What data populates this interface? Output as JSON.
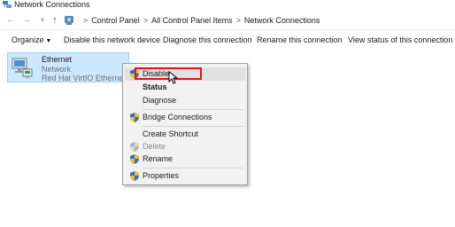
{
  "window": {
    "title": "Network Connections"
  },
  "address": {
    "breadcrumbs": [
      "Control Panel",
      "All Control Panel Items",
      "Network Connections"
    ]
  },
  "toolbar": {
    "organize": "Organize",
    "disable": "Disable this network device",
    "diagnose": "Diagnose this connection",
    "rename": "Rename this connection",
    "status": "View status of this connection"
  },
  "adapter": {
    "name": "Ethernet",
    "network": "Network",
    "device": "Red Hat VirtIO Ethernet Adapter"
  },
  "context_menu": {
    "items": [
      "Disable",
      "Status",
      "Diagnose",
      "Bridge Connections",
      "Create Shortcut",
      "Delete",
      "Rename",
      "Properties"
    ]
  },
  "colors": {
    "selection_fill": "#cce8ff",
    "selection_border": "#99d1ff",
    "highlight_border": "#e0141e",
    "menu_bg": "#f2f2f2"
  }
}
